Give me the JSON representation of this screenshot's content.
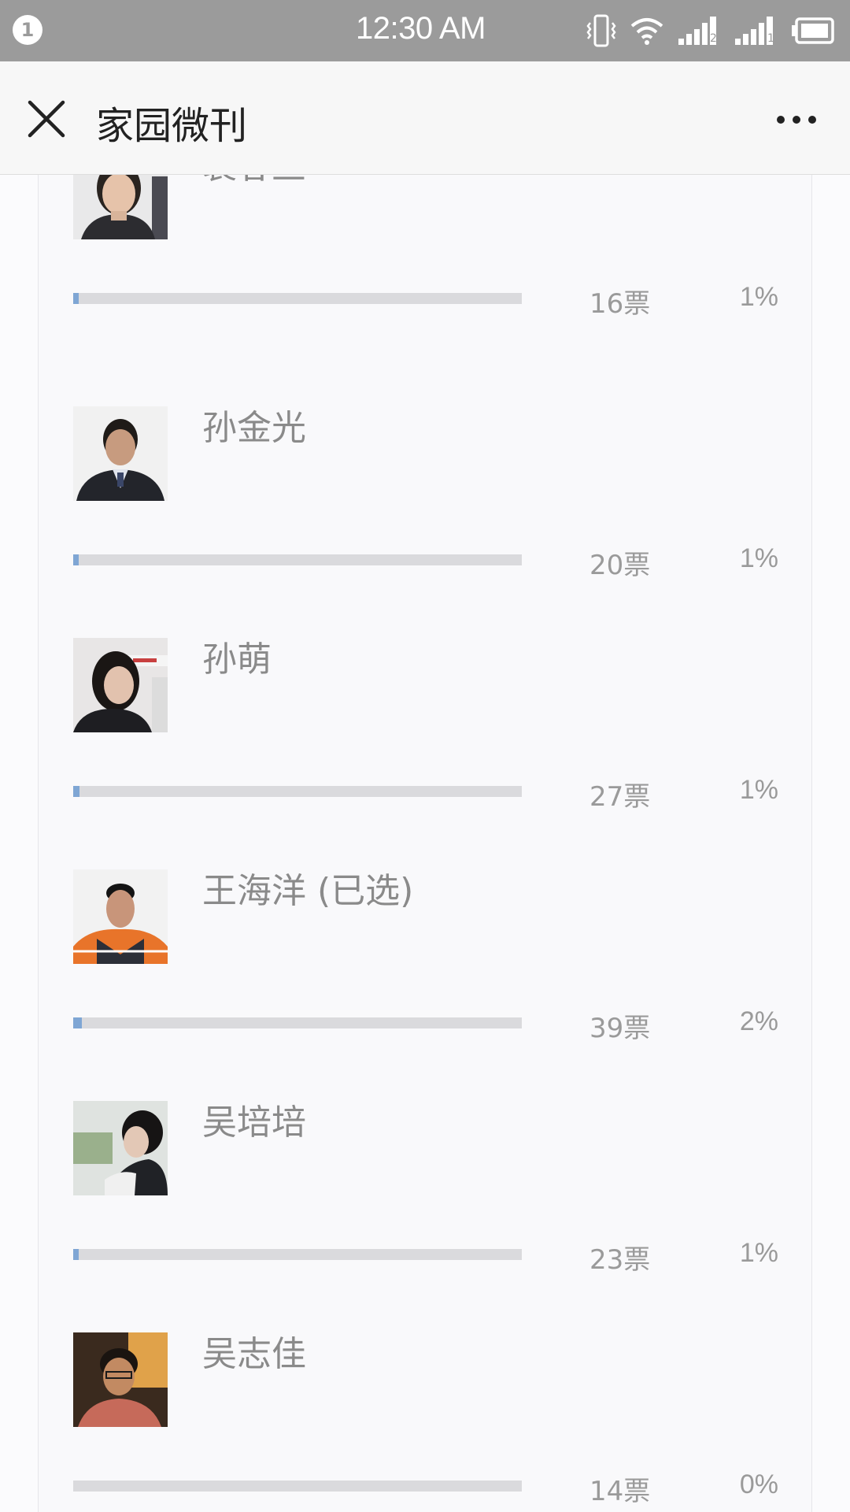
{
  "status_bar": {
    "notification_count": "1",
    "time": "12:30 AM",
    "icons": [
      "vibrate-icon",
      "wifi-icon",
      "signal-sim2-icon",
      "signal-sim1-icon",
      "battery-icon"
    ]
  },
  "header": {
    "title": "家园微刊",
    "close_icon": "close-icon",
    "more_icon": "more-icon"
  },
  "candidates": [
    {
      "name": "裴春兰",
      "votes": "16票",
      "percent": "1%",
      "ratio": 0.012
    },
    {
      "name": "孙金光",
      "votes": "20票",
      "percent": "1%",
      "ratio": 0.013
    },
    {
      "name": "孙萌",
      "votes": "27票",
      "percent": "1%",
      "ratio": 0.014
    },
    {
      "name": "王海洋 (已选)",
      "votes": "39票",
      "percent": "2%",
      "ratio": 0.02
    },
    {
      "name": "吴培培",
      "votes": "23票",
      "percent": "1%",
      "ratio": 0.013
    },
    {
      "name": "吴志佳",
      "votes": "14票",
      "percent": "0%",
      "ratio": 0.0
    }
  ],
  "colors": {
    "status_bar": "#9b9b9b",
    "bar_fill": "#7fa6d4",
    "bar_track": "#dadadd"
  }
}
